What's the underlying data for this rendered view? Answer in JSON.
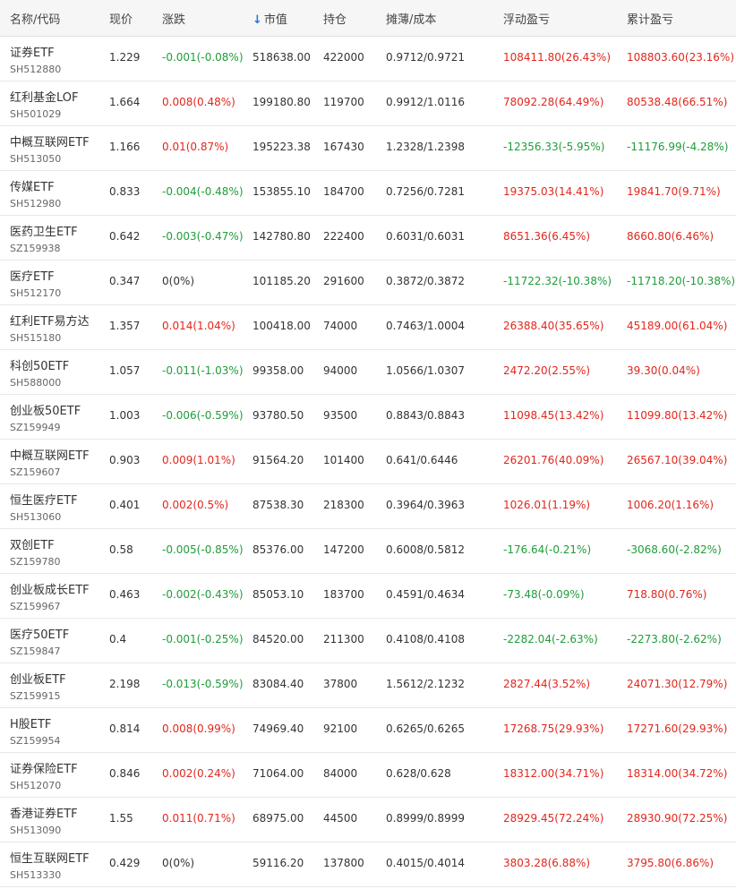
{
  "header": {
    "name": "名称/代码",
    "price": "现价",
    "change": "涨跌",
    "sort_arrow": "↓",
    "market_value": "市值",
    "holdings": "持仓",
    "cost": "摊薄/成本",
    "float_pl": "浮动盈亏",
    "cum_pl": "累计盈亏"
  },
  "colors": {
    "up": "#e0271d",
    "down": "#1f9d3a",
    "sort": "#1e78d6"
  },
  "rows": [
    {
      "name": "证券ETF",
      "code": "SH512880",
      "price": "1.229",
      "change": "-0.001(-0.08%)",
      "chg_dir": "down",
      "mv": "518638.00",
      "hold": "422000",
      "cost": "0.9712/0.9721",
      "float": "108411.80(26.43%)",
      "float_dir": "up",
      "cum": "108803.60(23.16%)",
      "cum_dir": "up"
    },
    {
      "name": "红利基金LOF",
      "code": "SH501029",
      "price": "1.664",
      "change": "0.008(0.48%)",
      "chg_dir": "up",
      "mv": "199180.80",
      "hold": "119700",
      "cost": "0.9912/1.0116",
      "float": "78092.28(64.49%)",
      "float_dir": "up",
      "cum": "80538.48(66.51%)",
      "cum_dir": "up"
    },
    {
      "name": "中概互联网ETF",
      "code": "SH513050",
      "price": "1.166",
      "change": "0.01(0.87%)",
      "chg_dir": "up",
      "mv": "195223.38",
      "hold": "167430",
      "cost": "1.2328/1.2398",
      "float": "-12356.33(-5.95%)",
      "float_dir": "down",
      "cum": "-11176.99(-4.28%)",
      "cum_dir": "down"
    },
    {
      "name": "传媒ETF",
      "code": "SH512980",
      "price": "0.833",
      "change": "-0.004(-0.48%)",
      "chg_dir": "down",
      "mv": "153855.10",
      "hold": "184700",
      "cost": "0.7256/0.7281",
      "float": "19375.03(14.41%)",
      "float_dir": "up",
      "cum": "19841.70(9.71%)",
      "cum_dir": "up"
    },
    {
      "name": "医药卫生ETF",
      "code": "SZ159938",
      "price": "0.642",
      "change": "-0.003(-0.47%)",
      "chg_dir": "down",
      "mv": "142780.80",
      "hold": "222400",
      "cost": "0.6031/0.6031",
      "float": "8651.36(6.45%)",
      "float_dir": "up",
      "cum": "8660.80(6.46%)",
      "cum_dir": "up"
    },
    {
      "name": "医疗ETF",
      "code": "SH512170",
      "price": "0.347",
      "change": "0(0%)",
      "chg_dir": "flat",
      "mv": "101185.20",
      "hold": "291600",
      "cost": "0.3872/0.3872",
      "float": "-11722.32(-10.38%)",
      "float_dir": "down",
      "cum": "-11718.20(-10.38%)",
      "cum_dir": "down"
    },
    {
      "name": "红利ETF易方达",
      "code": "SH515180",
      "price": "1.357",
      "change": "0.014(1.04%)",
      "chg_dir": "up",
      "mv": "100418.00",
      "hold": "74000",
      "cost": "0.7463/1.0004",
      "float": "26388.40(35.65%)",
      "float_dir": "up",
      "cum": "45189.00(61.04%)",
      "cum_dir": "up"
    },
    {
      "name": "科创50ETF",
      "code": "SH588000",
      "price": "1.057",
      "change": "-0.011(-1.03%)",
      "chg_dir": "down",
      "mv": "99358.00",
      "hold": "94000",
      "cost": "1.0566/1.0307",
      "float": "2472.20(2.55%)",
      "float_dir": "up",
      "cum": "39.30(0.04%)",
      "cum_dir": "up"
    },
    {
      "name": "创业板50ETF",
      "code": "SZ159949",
      "price": "1.003",
      "change": "-0.006(-0.59%)",
      "chg_dir": "down",
      "mv": "93780.50",
      "hold": "93500",
      "cost": "0.8843/0.8843",
      "float": "11098.45(13.42%)",
      "float_dir": "up",
      "cum": "11099.80(13.42%)",
      "cum_dir": "up"
    },
    {
      "name": "中概互联网ETF",
      "code": "SZ159607",
      "price": "0.903",
      "change": "0.009(1.01%)",
      "chg_dir": "up",
      "mv": "91564.20",
      "hold": "101400",
      "cost": "0.641/0.6446",
      "float": "26201.76(40.09%)",
      "float_dir": "up",
      "cum": "26567.10(39.04%)",
      "cum_dir": "up"
    },
    {
      "name": "恒生医疗ETF",
      "code": "SH513060",
      "price": "0.401",
      "change": "0.002(0.5%)",
      "chg_dir": "up",
      "mv": "87538.30",
      "hold": "218300",
      "cost": "0.3964/0.3963",
      "float": "1026.01(1.19%)",
      "float_dir": "up",
      "cum": "1006.20(1.16%)",
      "cum_dir": "up"
    },
    {
      "name": "双创ETF",
      "code": "SZ159780",
      "price": "0.58",
      "change": "-0.005(-0.85%)",
      "chg_dir": "down",
      "mv": "85376.00",
      "hold": "147200",
      "cost": "0.6008/0.5812",
      "float": "-176.64(-0.21%)",
      "float_dir": "down",
      "cum": "-3068.60(-2.82%)",
      "cum_dir": "down"
    },
    {
      "name": "创业板成长ETF",
      "code": "SZ159967",
      "price": "0.463",
      "change": "-0.002(-0.43%)",
      "chg_dir": "down",
      "mv": "85053.10",
      "hold": "183700",
      "cost": "0.4591/0.4634",
      "float": "-73.48(-0.09%)",
      "float_dir": "down",
      "cum": "718.80(0.76%)",
      "cum_dir": "up"
    },
    {
      "name": "医疗50ETF",
      "code": "SZ159847",
      "price": "0.4",
      "change": "-0.001(-0.25%)",
      "chg_dir": "down",
      "mv": "84520.00",
      "hold": "211300",
      "cost": "0.4108/0.4108",
      "float": "-2282.04(-2.63%)",
      "float_dir": "down",
      "cum": "-2273.80(-2.62%)",
      "cum_dir": "down"
    },
    {
      "name": "创业板ETF",
      "code": "SZ159915",
      "price": "2.198",
      "change": "-0.013(-0.59%)",
      "chg_dir": "down",
      "mv": "83084.40",
      "hold": "37800",
      "cost": "1.5612/2.1232",
      "float": "2827.44(3.52%)",
      "float_dir": "up",
      "cum": "24071.30(12.79%)",
      "cum_dir": "up"
    },
    {
      "name": "H股ETF",
      "code": "SZ159954",
      "price": "0.814",
      "change": "0.008(0.99%)",
      "chg_dir": "up",
      "mv": "74969.40",
      "hold": "92100",
      "cost": "0.6265/0.6265",
      "float": "17268.75(29.93%)",
      "float_dir": "up",
      "cum": "17271.60(29.93%)",
      "cum_dir": "up"
    },
    {
      "name": "证券保险ETF",
      "code": "SH512070",
      "price": "0.846",
      "change": "0.002(0.24%)",
      "chg_dir": "up",
      "mv": "71064.00",
      "hold": "84000",
      "cost": "0.628/0.628",
      "float": "18312.00(34.71%)",
      "float_dir": "up",
      "cum": "18314.00(34.72%)",
      "cum_dir": "up"
    },
    {
      "name": "香港证券ETF",
      "code": "SH513090",
      "price": "1.55",
      "change": "0.011(0.71%)",
      "chg_dir": "up",
      "mv": "68975.00",
      "hold": "44500",
      "cost": "0.8999/0.8999",
      "float": "28929.45(72.24%)",
      "float_dir": "up",
      "cum": "28930.90(72.25%)",
      "cum_dir": "up"
    },
    {
      "name": "恒生互联网ETF",
      "code": "SH513330",
      "price": "0.429",
      "change": "0(0%)",
      "chg_dir": "flat",
      "mv": "59116.20",
      "hold": "137800",
      "cost": "0.4015/0.4014",
      "float": "3803.28(6.88%)",
      "float_dir": "up",
      "cum": "3795.80(6.86%)",
      "cum_dir": "up"
    }
  ]
}
